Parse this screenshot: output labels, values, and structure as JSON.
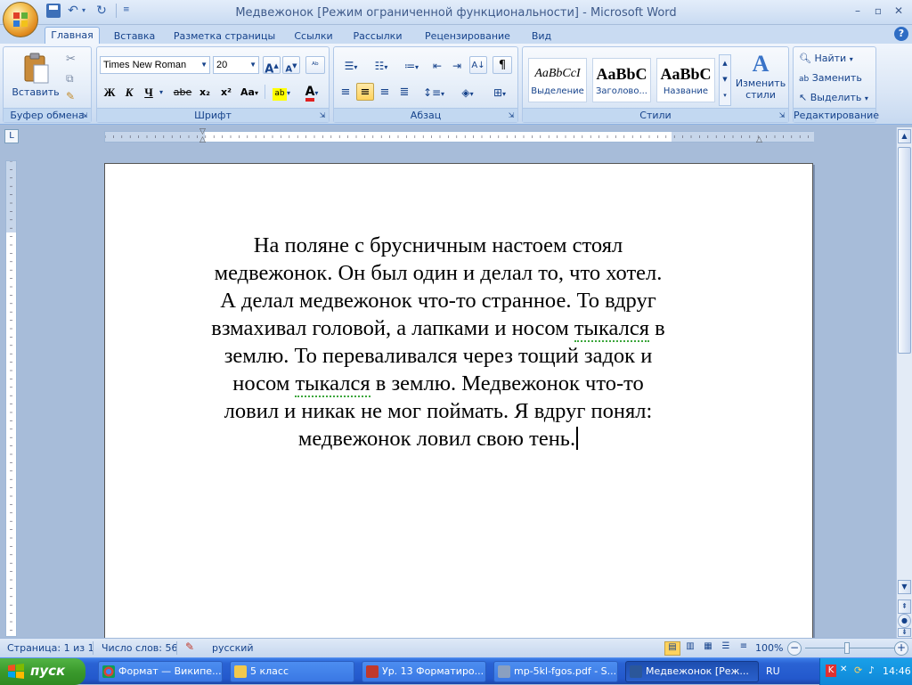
{
  "window": {
    "title": "Медвежонок [Режим ограниченной функциональности] - Microsoft Word"
  },
  "tabs": [
    "Главная",
    "Вставка",
    "Разметка страницы",
    "Ссылки",
    "Рассылки",
    "Рецензирование",
    "Вид"
  ],
  "active_tab": "Главная",
  "ribbon": {
    "clipboard": {
      "label": "Буфер обмена",
      "paste": "Вставить"
    },
    "font": {
      "label": "Шрифт",
      "family": "Times New Roman",
      "size": "20",
      "bold": "Ж",
      "italic": "К",
      "underline": "Ч",
      "strike": "abe",
      "sub": "x₂",
      "sup": "x²",
      "case": "Aa"
    },
    "paragraph": {
      "label": "Абзац"
    },
    "styles": {
      "label": "Стили",
      "items": [
        {
          "sample": "AaBbCcI",
          "name": "Выделение"
        },
        {
          "sample": "AaBbC",
          "name": "Заголово..."
        },
        {
          "sample": "AaBbC",
          "name": "Название"
        }
      ],
      "change_styles": "Изменить стили"
    },
    "editing": {
      "label": "Редактирование",
      "find": "Найти",
      "replace": "Заменить",
      "select": "Выделить"
    }
  },
  "document": {
    "parts": [
      "На поляне с брусничным настоем стоял медвежонок. Он был один и делал то, что хотел. А делал медвежонок что-то странное. То вдруг взмахивал головой, а лапками и носом ",
      "тыкался",
      " в землю. То переваливался через тощий задок и носом ",
      "тыкался",
      " в землю. Медвежонок что-то ловил и никак не мог поймать. Я вдруг понял: медвежонок ловил свою тень."
    ]
  },
  "statusbar": {
    "page": "Страница: 1 из 1",
    "words": "Число слов: 56",
    "language": "русский",
    "zoom": "100%"
  },
  "taskbar": {
    "start": "пуск",
    "items": [
      {
        "label": "Формат — Википе..."
      },
      {
        "label": "5 класс"
      },
      {
        "label": "Ур. 13 Форматиро..."
      },
      {
        "label": "mp-5kl-fgos.pdf - S..."
      },
      {
        "label": "Медвежонок [Реж..."
      }
    ],
    "lang": "RU",
    "time": "14:46"
  },
  "colors": {
    "ribbon_blue": "#15428b",
    "page_bg": "#a7bcd9",
    "taskbar": "#2358cc",
    "start_green": "#3a9a2c"
  }
}
